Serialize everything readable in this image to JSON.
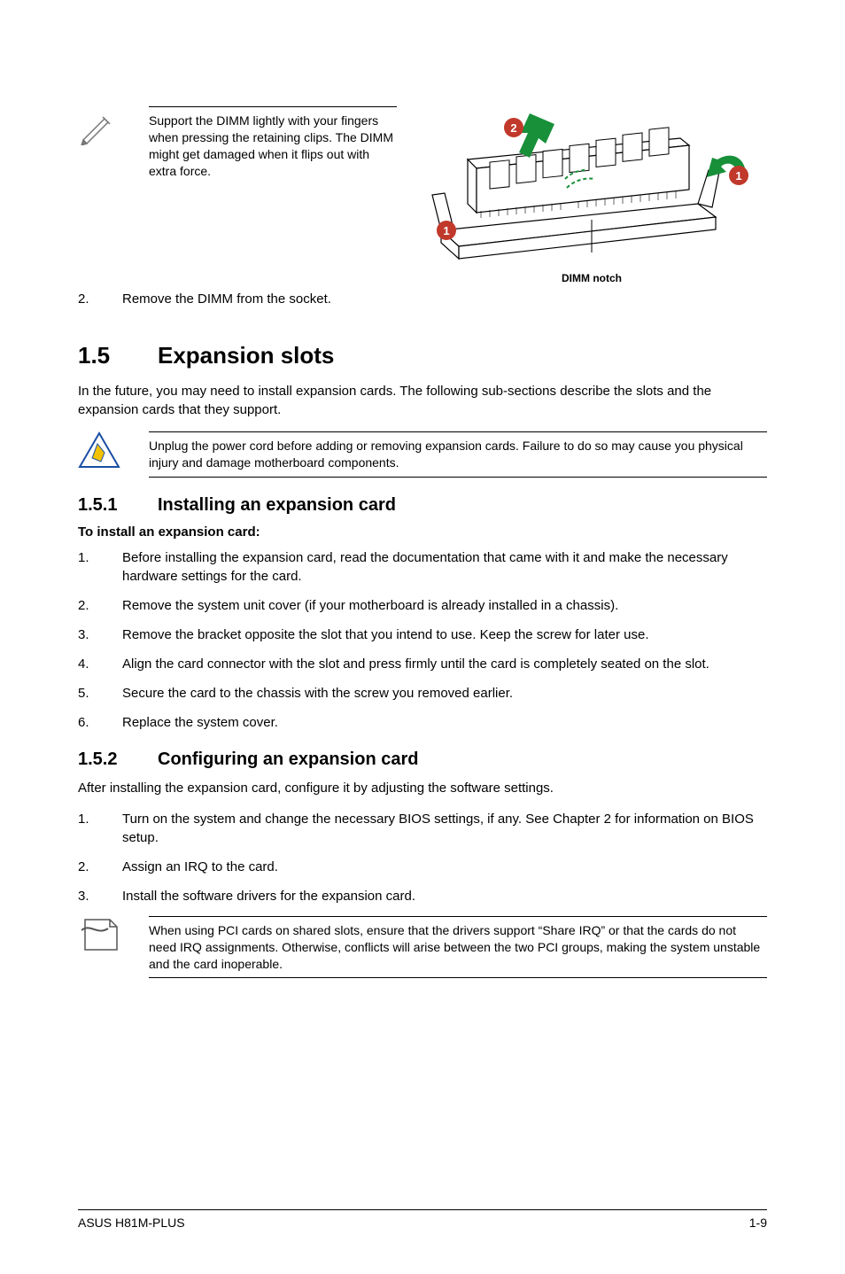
{
  "top_callout": {
    "text": "Support the DIMM lightly with your fingers when pressing the retaining clips. The DIMM might get damaged when it flips out with extra force."
  },
  "illustration": {
    "label": "DIMM notch",
    "badges": [
      "1",
      "2",
      "1"
    ]
  },
  "step2": {
    "n": "2.",
    "t": "Remove the DIMM from the socket."
  },
  "s15": {
    "no": "1.5",
    "title": "Expansion slots",
    "intro": "In the future, you may need to install expansion cards. The following sub-sections describe the slots and the expansion cards that they support.",
    "warning": "Unplug the power cord before adding or removing expansion cards. Failure to do so may cause you physical injury and damage motherboard components."
  },
  "s151": {
    "no": "1.5.1",
    "title": "Installing an expansion card",
    "lead": "To install an expansion card:",
    "items": [
      {
        "n": "1.",
        "t": "Before installing the expansion card, read the documentation that came with it and make the necessary hardware settings for the card."
      },
      {
        "n": "2.",
        "t": "Remove the system unit cover (if your motherboard is already installed in a chassis)."
      },
      {
        "n": "3.",
        "t": "Remove the bracket opposite the slot that you intend to use. Keep the screw for later use."
      },
      {
        "n": "4.",
        "t": "Align the card connector with the slot and press firmly until the card is completely seated on the slot."
      },
      {
        "n": "5.",
        "t": "Secure the card to the chassis with the screw you removed earlier."
      },
      {
        "n": "6.",
        "t": "Replace the system cover."
      }
    ]
  },
  "s152": {
    "no": "1.5.2",
    "title": "Configuring an expansion card",
    "intro": "After installing the expansion card, configure it by adjusting the software settings.",
    "items": [
      {
        "n": "1.",
        "t": "Turn on the system and change the necessary BIOS settings, if any. See Chapter 2 for information on BIOS setup."
      },
      {
        "n": "2.",
        "t": "Assign an IRQ to the card."
      },
      {
        "n": "3.",
        "t": "Install the software drivers for the expansion card."
      }
    ],
    "note": "When using PCI cards on shared slots, ensure that the drivers support “Share IRQ” or that the cards do not need IRQ assignments. Otherwise, conflicts will arise between the two PCI groups, making the system unstable and the card inoperable."
  },
  "footer": {
    "left": "ASUS H81M-PLUS",
    "right": "1-9"
  }
}
